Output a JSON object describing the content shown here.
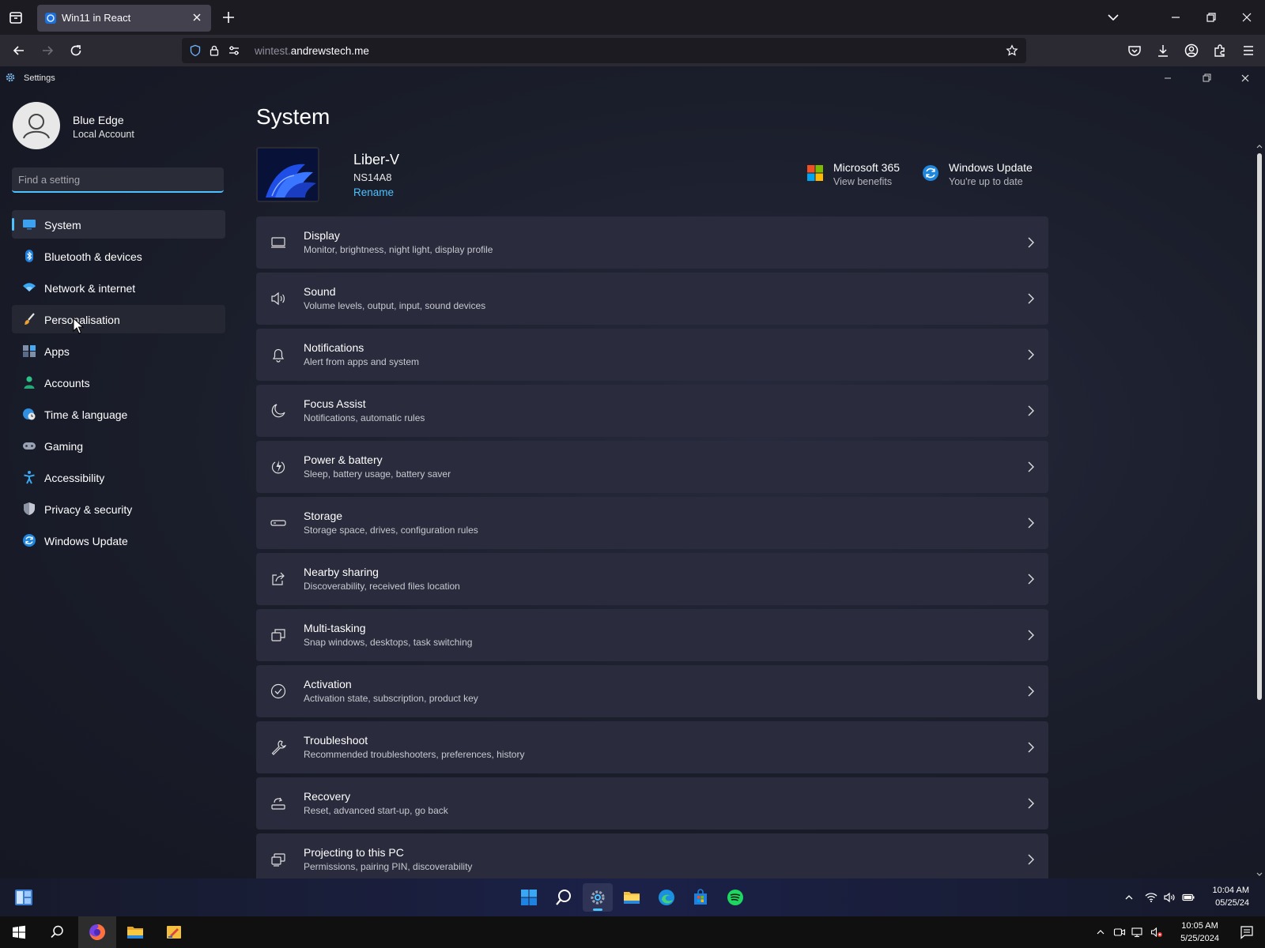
{
  "browser": {
    "tab_title": "Win11 in React",
    "url_domain": "wintest.",
    "url_host": "andrewstech.me"
  },
  "settings_window": {
    "title": "Settings"
  },
  "sidebar": {
    "user_name": "Blue Edge",
    "user_account_type": "Local Account",
    "search_placeholder": "Find a setting",
    "items": [
      {
        "label": "System",
        "icon": "monitor-icon",
        "state": "selected"
      },
      {
        "label": "Bluetooth & devices",
        "icon": "bluetooth-icon"
      },
      {
        "label": "Network & internet",
        "icon": "wifi-icon"
      },
      {
        "label": "Personalisation",
        "icon": "brush-icon",
        "state": "hover"
      },
      {
        "label": "Apps",
        "icon": "apps-icon"
      },
      {
        "label": "Accounts",
        "icon": "person-icon"
      },
      {
        "label": "Time & language",
        "icon": "globe-clock-icon"
      },
      {
        "label": "Gaming",
        "icon": "gamepad-icon"
      },
      {
        "label": "Accessibility",
        "icon": "accessibility-icon"
      },
      {
        "label": "Privacy & security",
        "icon": "shield-icon"
      },
      {
        "label": "Windows Update",
        "icon": "update-icon"
      }
    ]
  },
  "main": {
    "title": "System",
    "device": {
      "name": "Liber-V",
      "model": "NS14A8",
      "rename_label": "Rename"
    },
    "promos": [
      {
        "title": "Microsoft 365",
        "subtitle": "View benefits",
        "icon": "microsoft-logo-icon"
      },
      {
        "title": "Windows Update",
        "subtitle": "You're up to date",
        "icon": "update-icon"
      }
    ],
    "cards": [
      {
        "title": "Display",
        "subtitle": "Monitor, brightness, night light, display profile",
        "icon": "display-icon"
      },
      {
        "title": "Sound",
        "subtitle": "Volume levels, output, input, sound devices",
        "icon": "speaker-icon"
      },
      {
        "title": "Notifications",
        "subtitle": "Alert from apps and system",
        "icon": "bell-icon"
      },
      {
        "title": "Focus Assist",
        "subtitle": "Notifications, automatic rules",
        "icon": "moon-icon"
      },
      {
        "title": "Power & battery",
        "subtitle": "Sleep, battery usage, battery saver",
        "icon": "power-icon"
      },
      {
        "title": "Storage",
        "subtitle": "Storage space, drives, configuration rules",
        "icon": "storage-icon"
      },
      {
        "title": "Nearby sharing",
        "subtitle": "Discoverability, received files location",
        "icon": "share-icon"
      },
      {
        "title": "Multi-tasking",
        "subtitle": "Snap windows, desktops, task switching",
        "icon": "multitask-icon"
      },
      {
        "title": "Activation",
        "subtitle": "Activation state, subscription, product key",
        "icon": "check-circle-icon"
      },
      {
        "title": "Troubleshoot",
        "subtitle": "Recommended troubleshooters, preferences, history",
        "icon": "wrench-icon"
      },
      {
        "title": "Recovery",
        "subtitle": "Reset, advanced start-up, go back",
        "icon": "recovery-icon"
      },
      {
        "title": "Projecting to this PC",
        "subtitle": "Permissions, pairing PIN, discoverability",
        "icon": "projector-icon"
      }
    ]
  },
  "web_taskbar": {
    "time": "10:04 AM",
    "date": "05/25/24"
  },
  "os_taskbar": {
    "time": "10:05 AM",
    "date": "5/25/2024"
  }
}
